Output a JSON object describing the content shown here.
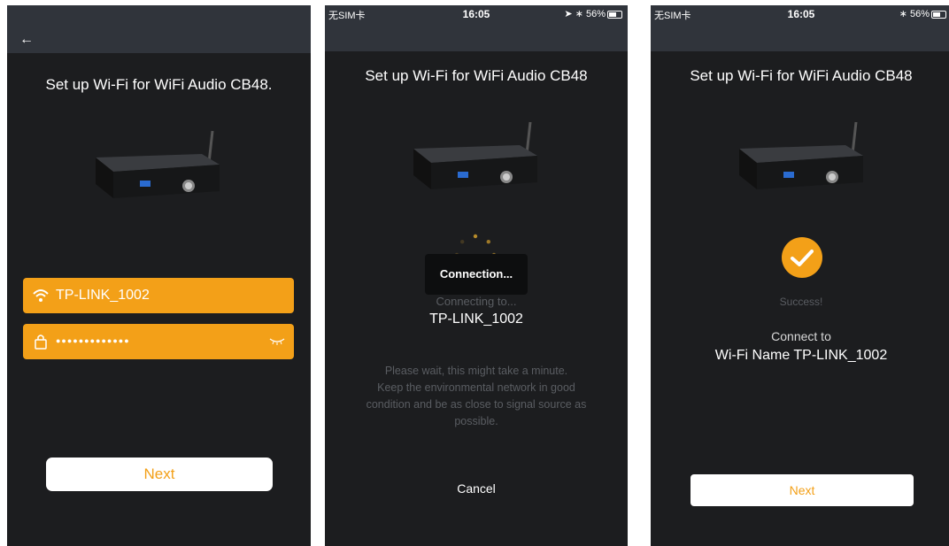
{
  "screen1": {
    "title": "Set up Wi-Fi for WiFi Audio CB48.",
    "wifi_ssid": "TP-LINK_1002",
    "password_masked": "●●●●●●●●●●●●●",
    "next_label": "Next"
  },
  "screen2": {
    "status": {
      "carrier": "无SIM卡",
      "time": "16:05",
      "battery": "56%"
    },
    "title": "Set up Wi-Fi for WiFi Audio CB48",
    "toast": "Connection...",
    "connecting_to": "Connecting to...",
    "ssid": "TP-LINK_1002",
    "wait_msg_lines": [
      "Please wait, this might take a minute.",
      "Keep the environmental network in good",
      "condition and be as close to signal source as",
      "possible."
    ],
    "cancel_label": "Cancel"
  },
  "screen3": {
    "status": {
      "carrier": "无SIM卡",
      "time": "16:05",
      "battery": "56%"
    },
    "title": "Set up Wi-Fi for WiFi Audio CB48",
    "success": "Success!",
    "connect_to": "Connect to",
    "wifi_name": "Wi-Fi Name TP-LINK_1002",
    "next_label": "Next"
  },
  "colors": {
    "accent": "#f3a018",
    "background": "#1c1d1f",
    "header": "#30343b"
  }
}
